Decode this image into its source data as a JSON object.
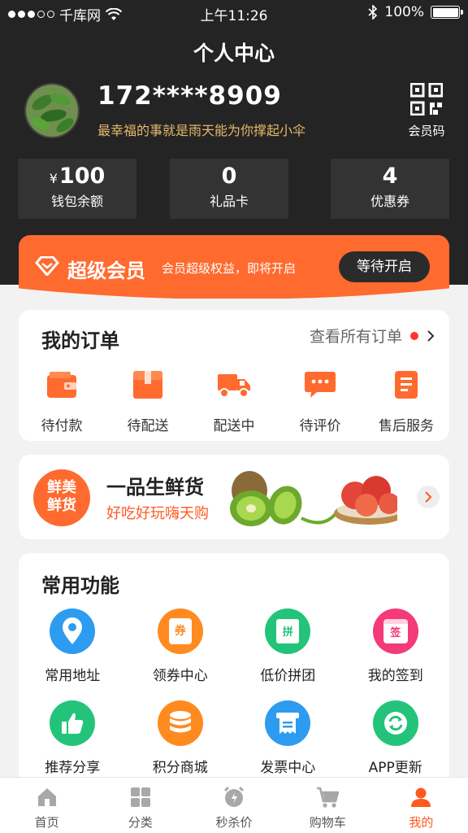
{
  "status_bar": {
    "carrier": "千库网",
    "time": "上午11:26",
    "battery": "100%",
    "battery_level": 1.0
  },
  "page_title": "个人中心",
  "profile": {
    "phone": "172****8909",
    "slogan": "最幸福的事就是雨天能为你撑起小伞",
    "qr_label": "会员码"
  },
  "stats": [
    {
      "prefix": "¥",
      "value": "100",
      "label": "钱包余额"
    },
    {
      "prefix": "",
      "value": "0",
      "label": "礼品卡"
    },
    {
      "prefix": "",
      "value": "4",
      "label": "优惠券"
    }
  ],
  "vip": {
    "title": "超级会员",
    "desc": "会员超级权益，即将开启",
    "button": "等待开启"
  },
  "orders": {
    "title": "我的订单",
    "view_all": "查看所有订单",
    "items": [
      {
        "label": "待付款",
        "icon": "wallet-icon"
      },
      {
        "label": "待配送",
        "icon": "package-icon"
      },
      {
        "label": "配送中",
        "icon": "truck-icon"
      },
      {
        "label": "待评价",
        "icon": "comment-icon"
      },
      {
        "label": "售后服务",
        "icon": "document-icon"
      }
    ]
  },
  "promo": {
    "badge_line1": "鲜美",
    "badge_line2": "鲜货",
    "title": "一品生鲜货",
    "subtitle": "好吃好玩嗨天购"
  },
  "functions": {
    "title": "常用功能",
    "items": [
      {
        "label": "常用地址",
        "icon": "location-pin-icon",
        "color": "#2d9cf0"
      },
      {
        "label": "领券中心",
        "icon": "coupon-icon",
        "color": "#ff8a1f"
      },
      {
        "label": "低价拼团",
        "icon": "shopping-bag-icon",
        "color": "#23c47a"
      },
      {
        "label": "我的签到",
        "icon": "calendar-icon",
        "color": "#f43a7a"
      },
      {
        "label": "推荐分享",
        "icon": "thumbs-up-icon",
        "color": "#23c47a"
      },
      {
        "label": "积分商城",
        "icon": "database-icon",
        "color": "#ff8a1f"
      },
      {
        "label": "发票中心",
        "icon": "invoice-icon",
        "color": "#2d9cf0"
      },
      {
        "label": "APP更新",
        "icon": "refresh-icon",
        "color": "#23c47a"
      }
    ],
    "coupon_glyph": "券",
    "group_glyph": "拼",
    "sign_glyph": "签"
  },
  "tabs": [
    {
      "label": "首页",
      "icon": "home-icon",
      "active": false
    },
    {
      "label": "分类",
      "icon": "grid-icon",
      "active": false
    },
    {
      "label": "秒杀价",
      "icon": "alarm-icon",
      "active": false
    },
    {
      "label": "购物车",
      "icon": "cart-icon",
      "active": false
    },
    {
      "label": "我的",
      "icon": "user-icon",
      "active": true
    }
  ],
  "colors": {
    "accent": "#ff6a2f",
    "header_bg": "#242424",
    "gold_text": "#e6b86a"
  }
}
